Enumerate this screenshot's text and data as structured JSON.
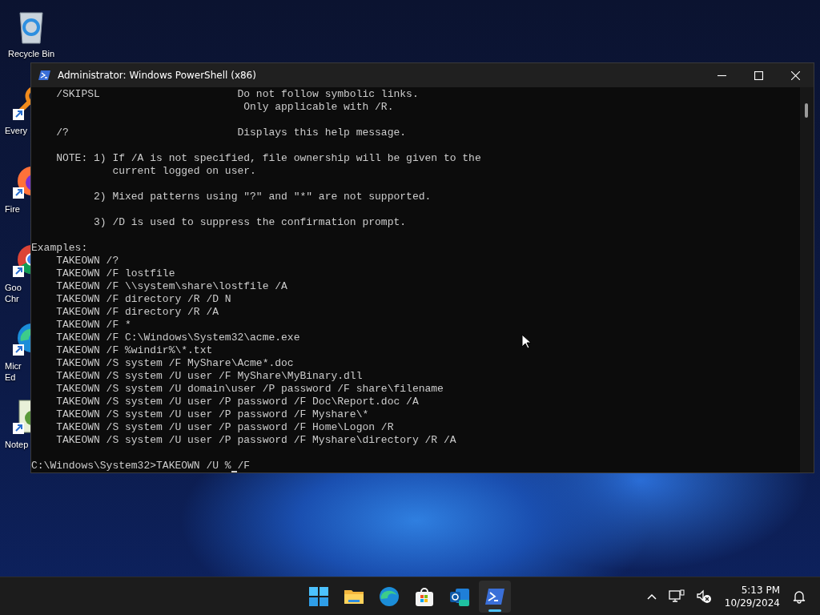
{
  "desktop_icons": [
    {
      "kind": "recycle",
      "label": [
        "Recycle Bin"
      ]
    },
    {
      "kind": "search",
      "label": [
        "Every"
      ]
    },
    {
      "kind": "firefox",
      "label": [
        "Fire"
      ]
    },
    {
      "kind": "chrome",
      "label": [
        "Goo",
        "Chr"
      ]
    },
    {
      "kind": "edge",
      "label": [
        "Micr",
        "Ed"
      ]
    },
    {
      "kind": "notepad",
      "label": [
        "Notep"
      ]
    }
  ],
  "window": {
    "title": "Administrator: Windows PowerShell (x86)",
    "console": {
      "paragraphs": [
        [
          "    /SKIPSL                      Do not follow symbolic links.",
          "                                  Only applicable with /R."
        ],
        [
          "    /?                           Displays this help message."
        ],
        [
          "    NOTE: 1) If /A is not specified, file ownership will be given to the",
          "             current logged on user."
        ],
        [
          "          2) Mixed patterns using \"?\" and \"*\" are not supported."
        ],
        [
          "          3) /D is used to suppress the confirmation prompt."
        ],
        [
          "Examples:",
          "    TAKEOWN /?",
          "    TAKEOWN /F lostfile",
          "    TAKEOWN /F \\\\system\\share\\lostfile /A",
          "    TAKEOWN /F directory /R /D N",
          "    TAKEOWN /F directory /R /A",
          "    TAKEOWN /F *",
          "    TAKEOWN /F C:\\Windows\\System32\\acme.exe",
          "    TAKEOWN /F %windir%\\*.txt",
          "    TAKEOWN /S system /F MyShare\\Acme*.doc",
          "    TAKEOWN /S system /U user /F MyShare\\MyBinary.dll",
          "    TAKEOWN /S system /U domain\\user /P password /F share\\filename",
          "    TAKEOWN /S system /U user /P password /F Doc\\Report.doc /A",
          "    TAKEOWN /S system /U user /P password /F Myshare\\*",
          "    TAKEOWN /S system /U user /P password /F Home\\Logon /R",
          "    TAKEOWN /S system /U user /P password /F Myshare\\directory /R /A"
        ]
      ],
      "prompt": {
        "before_cursor": "C:\\Windows\\System32>TAKEOWN /U %",
        "after_cursor": "/F"
      }
    }
  },
  "taskbar": {
    "apps": [
      {
        "kind": "start",
        "active": false
      },
      {
        "kind": "explorer",
        "active": false
      },
      {
        "kind": "edge",
        "active": false
      },
      {
        "kind": "store",
        "active": false
      },
      {
        "kind": "outlook",
        "active": false
      },
      {
        "kind": "powershell",
        "active": true
      }
    ],
    "time": "5:13 PM",
    "date": "10/29/2024"
  }
}
